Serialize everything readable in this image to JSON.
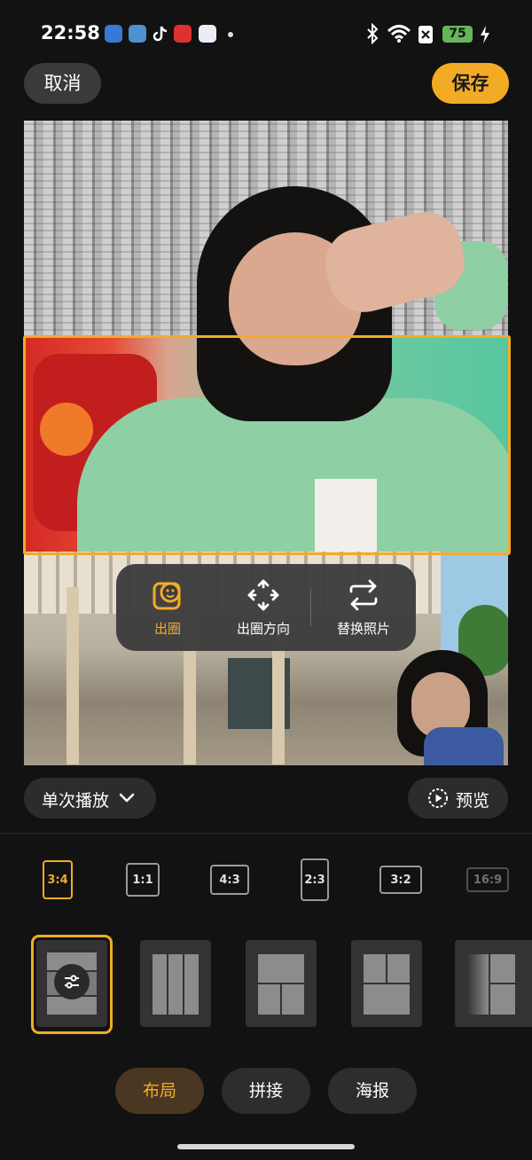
{
  "status_bar": {
    "time": "22:58",
    "battery": "75",
    "icons": [
      "notes-app-icon",
      "gallery-app-icon",
      "tiktok-icon",
      "xiaohongshu-icon",
      "browser-app-icon",
      "bluetooth-icon",
      "wifi-icon",
      "no-sim-icon",
      "charging-icon"
    ]
  },
  "header": {
    "cancel_label": "取消",
    "save_label": "保存"
  },
  "popup_menu": {
    "items": [
      {
        "label": "出圈",
        "icon": "cutout-icon",
        "active": true
      },
      {
        "label": "出圈方向",
        "icon": "move-arrows-icon",
        "active": false
      },
      {
        "label": "替换照片",
        "icon": "swap-icon",
        "active": false
      }
    ]
  },
  "playback": {
    "mode_label": "单次播放",
    "preview_label": "预览"
  },
  "aspect_ratios": [
    {
      "label": "3:4",
      "active": true
    },
    {
      "label": "1:1",
      "active": false
    },
    {
      "label": "4:3",
      "active": false
    },
    {
      "label": "2:3",
      "active": false
    },
    {
      "label": "3:2",
      "active": false
    },
    {
      "label": "16:9",
      "active": false
    }
  ],
  "layouts": [
    {
      "name": "three-row-stack",
      "selected": true
    },
    {
      "name": "three-column",
      "selected": false
    },
    {
      "name": "top-wide-two-bottom",
      "selected": false
    },
    {
      "name": "two-top-wide-bottom",
      "selected": false
    },
    {
      "name": "partial-grid",
      "selected": false
    }
  ],
  "tabs": [
    {
      "label": "布局",
      "active": true
    },
    {
      "label": "拼接",
      "active": false
    },
    {
      "label": "海报",
      "active": false
    }
  ],
  "colors": {
    "accent": "#f3ab26",
    "background": "#121212",
    "surface": "#2d2d2d"
  }
}
